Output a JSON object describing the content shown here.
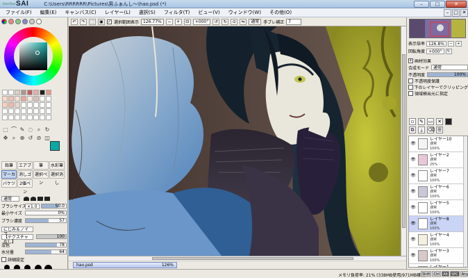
{
  "window": {
    "logo_small": "PaintTool",
    "logo_main": "SAI",
    "title": "C:\\Users\\RRRRRR\\Pictures\\男ふぁんし～\\hao.psd (*)",
    "minimize": "–",
    "maximize": "□",
    "close": "✕"
  },
  "menu": [
    "ファイル(F)",
    "編集(E)",
    "キャンバス(C)",
    "レイヤー(L)",
    "選択(S)",
    "フィルタ(T)",
    "ビュー(V)",
    "ウィンドウ(W)",
    "その他(O)"
  ],
  "menu_right": [
    "–",
    "□",
    "✕"
  ],
  "canvas_toolbar": {
    "selection_label": "選択範囲表示",
    "zoom": "126.77%",
    "rotation": "+000°",
    "blend_mode": "通常",
    "stabilizer_label": "手ブレ補正",
    "stabilizer_value": "7"
  },
  "colors": {
    "accent_teal": "#0aa8a4",
    "selection_blue": "#c9d4f6"
  },
  "swatch_colors": [
    "#ffffff",
    "#ffffff",
    "#d8d0c8",
    "#a89890",
    "#c06060",
    "#e0b0a8",
    "#202020",
    "#e89888",
    "#fbd8c8",
    "#f0c0b0",
    "#f4e0d8",
    "#e8a898",
    "#f8e8e0",
    "#d8c0b8",
    "#ffffff",
    "#ffffff",
    "#f8d0c0",
    "#f0b8a8",
    "#e8d8d0",
    "#ffffff",
    "#ffffff",
    "#ffffff",
    "#ffffff",
    "#ffffff",
    "#ffffff",
    "#ffffff",
    "#ffffff",
    "#ffffff",
    "#ffffff",
    "#ffffff",
    "#ffffff",
    "#ffffff",
    "#ffffff",
    "#ffffff",
    "#ffffff",
    "#ffffff",
    "#ffffff",
    "#ffffff",
    "#ffffff",
    "#ffffff"
  ],
  "tools_row1": [
    "⬚",
    "⌒",
    "✎",
    "◌",
    "⌕",
    "↻"
  ],
  "tools_row2": [
    "✥",
    "⌕",
    "⊕",
    "↺",
    "⊘",
    "◫"
  ],
  "brushes": [
    "鉛筆",
    "エアブラシ",
    "筆",
    "水彩筆",
    "マーカー",
    "消しゴム",
    "選択ペン",
    "選択消し",
    "バケツ",
    "2値ペン",
    "",
    ""
  ],
  "brush_props": {
    "shape_label": "通常",
    "size_label": "ブラシサイズ",
    "size_mult": "×1.0",
    "size_value": "50.0",
    "min_label": "最小サイズ",
    "min_value": "0%",
    "density_label": "ブラシ濃度",
    "density_value": "57",
    "density_pct": 57,
    "blend_label": "にじみ＆ノイズ",
    "texture_label": "【テクスチャなし】",
    "texture_value": "100",
    "mix_label": "混色",
    "mix_value": "78",
    "mix_pct": 78,
    "water_label": "水分量",
    "water_value": "64",
    "water_pct": 64,
    "keep_label": "色延び",
    "keep_value": "",
    "detail_label": "詳細設定"
  },
  "brush_sizes": [
    {
      "label": "25",
      "size": 8
    },
    {
      "label": "30",
      "size": 9
    },
    {
      "label": "35",
      "size": 9
    },
    {
      "label": "40",
      "size": 10
    },
    {
      "label": "50",
      "size": 11
    },
    {
      "label": "",
      "size": 0
    },
    {
      "label": "70",
      "size": 12
    },
    {
      "label": "80",
      "size": 12
    },
    {
      "label": "100",
      "size": 12
    },
    {
      "label": "120",
      "size": 12
    },
    {
      "label": "160",
      "size": 12
    },
    {
      "label": "200",
      "size": 12
    }
  ],
  "navigator": {
    "zoom_label": "表示倍率",
    "zoom_value": "126.8%",
    "angle_label": "回転角度",
    "angle_value": "+000°"
  },
  "layer_props": {
    "effect_label": "画材効果",
    "blend_label": "合成モード",
    "blend_value": "通常",
    "opacity_label": "不透明度",
    "opacity_value": "100%",
    "protect_label": "不透明度保護",
    "clip_label": "下のレイヤーでクリッピング",
    "source_label": "領域検出元に指定"
  },
  "layer_tools": [
    "📄",
    "📄",
    "📁",
    "🗑",
    "▭"
  ],
  "layer_tools2": [
    "⬓",
    "⬒",
    "⬚",
    "▤"
  ],
  "layers": [
    {
      "name": "レイヤー10",
      "mode": "通常",
      "opacity": "100%",
      "thumb": "#f4f4f4",
      "selected": false
    },
    {
      "name": "レイヤー2",
      "mode": "通常",
      "opacity": "25%",
      "thumb": "#e8c8d8",
      "selected": false
    },
    {
      "name": "レイヤー7",
      "mode": "通常",
      "opacity": "100%",
      "thumb": "#ffffff",
      "selected": false
    },
    {
      "name": "レイヤー6",
      "mode": "通常",
      "opacity": "100%",
      "thumb": "#c8c8d8",
      "selected": false
    },
    {
      "name": "レイヤー5",
      "mode": "通常",
      "opacity": "100%",
      "thumb": "#ffffff",
      "selected": false
    },
    {
      "name": "レイヤー8",
      "mode": "通常",
      "opacity": "100%",
      "thumb": "#ffffff",
      "selected": true
    },
    {
      "name": "レイヤー4",
      "mode": "通常",
      "opacity": "100%",
      "thumb": "#f4f0e0",
      "selected": false
    },
    {
      "name": "レイヤー3",
      "mode": "通常",
      "opacity": "100%",
      "thumb": "#d8c8c8",
      "selected": false
    },
    {
      "name": "レイヤー1",
      "mode": "通常",
      "opacity": "100%",
      "thumb": "#b8c050",
      "selected": false
    }
  ],
  "doc_tab": {
    "name": "hao.psd",
    "zoom": "126%"
  },
  "status": {
    "memory": "メモリ負荷率: 21% (338MB使用/971MB確保)",
    "keys": [
      "Shift",
      "Ctrl",
      "Alt",
      "SPC",
      "Any"
    ],
    "keys_on": [
      false,
      false,
      true,
      true,
      false
    ]
  }
}
